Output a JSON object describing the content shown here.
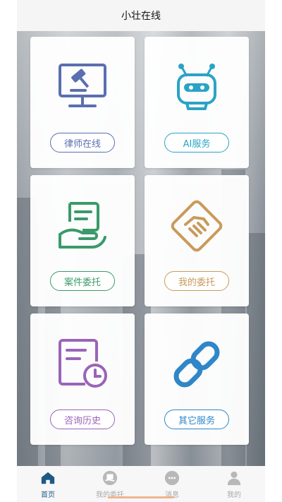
{
  "header": {
    "title": "小壮在线"
  },
  "cards": [
    {
      "label": "律师在线",
      "icon": "gavel-monitor-icon",
      "color": "#5b6fb0"
    },
    {
      "label": "AI服务",
      "icon": "robot-icon",
      "color": "#2aa3c5"
    },
    {
      "label": "案件委托",
      "icon": "hand-document-icon",
      "color": "#3a9a6a"
    },
    {
      "label": "我的委托",
      "icon": "handshake-icon",
      "color": "#c99a5a"
    },
    {
      "label": "咨询历史",
      "icon": "document-clock-icon",
      "color": "#9a64b8"
    },
    {
      "label": "其它服务",
      "icon": "link-icon",
      "color": "#2f86c8"
    }
  ],
  "tabbar": {
    "items": [
      {
        "label": "首页",
        "icon": "home-icon",
        "active": true
      },
      {
        "label": "我的委托",
        "icon": "commission-icon",
        "active": false
      },
      {
        "label": "消息",
        "icon": "message-icon",
        "active": false
      },
      {
        "label": "我的",
        "icon": "user-icon",
        "active": false
      }
    ],
    "active_color": "#1f5a86",
    "inactive_color": "#aaaaaa"
  }
}
